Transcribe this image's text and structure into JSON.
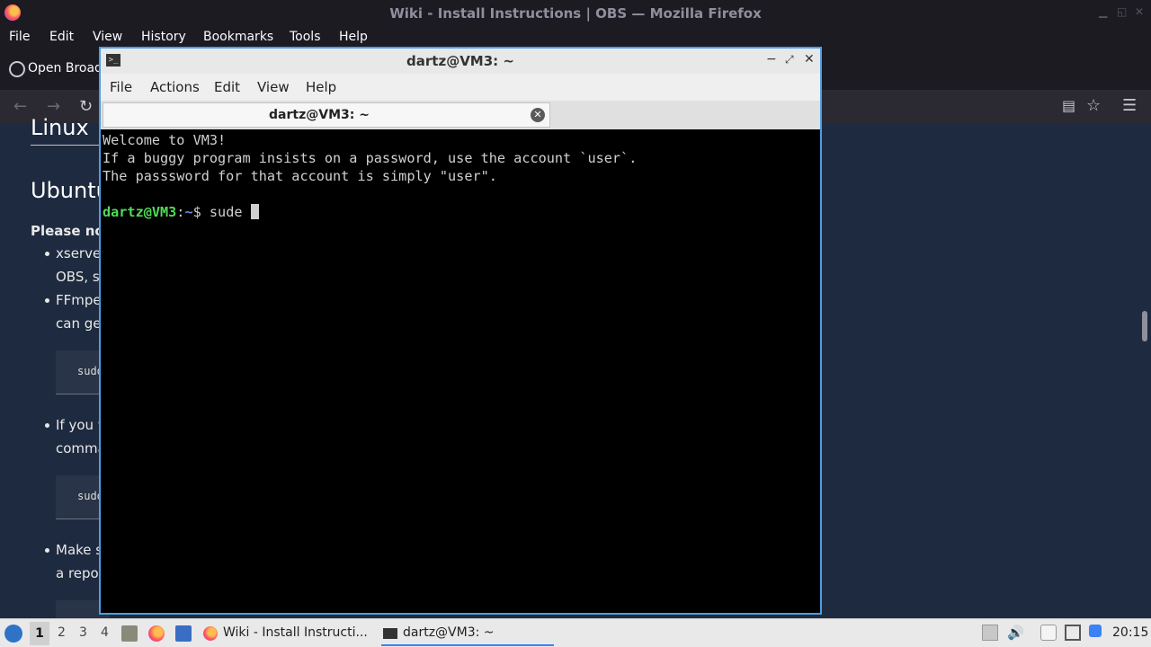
{
  "firefox": {
    "window_title": "Wiki - Install Instructions | OBS — Mozilla Firefox",
    "menu": [
      "File",
      "Edit",
      "View",
      "History",
      "Bookmarks",
      "Tools",
      "Help"
    ],
    "tab_label": "Open Broad",
    "page": {
      "heading_partial": "Linux",
      "section_heading": "Ubuntu",
      "note_label": "Please not",
      "bullet1_line1": "xserve",
      "bullet1_line2": "OBS, s",
      "bullet2_line1": "FFmpe",
      "bullet2_line2": "can ge",
      "code1": "sudo",
      "bullet3_line1": "If you w",
      "bullet3_line2": "comma",
      "code2": "sudo",
      "bullet4_line1": "Make s",
      "bullet4_line2": "a repos"
    }
  },
  "terminal": {
    "window_title": "dartz@VM3: ~",
    "menu": [
      "File",
      "Actions",
      "Edit",
      "View",
      "Help"
    ],
    "tab_label": "dartz@VM3: ~",
    "lines": [
      "Welcome to VM3!",
      "If a buggy program insists on a password, use the account `user`.",
      "The passsword for that account is simply \"user\"."
    ],
    "prompt_user": "dartz@VM3",
    "prompt_sep": ":",
    "prompt_path": "~",
    "prompt_symbol": "$ ",
    "command": "sude "
  },
  "taskbar": {
    "workspaces": [
      "1",
      "2",
      "3",
      "4"
    ],
    "apps": [
      {
        "label": "Wiki - Install Instructi..."
      },
      {
        "label": "dartz@VM3: ~"
      }
    ],
    "clock": "20:15"
  },
  "colors": {
    "terminal_border": "#4b9ee6",
    "prompt_user": "#4fdc57",
    "prompt_path": "#6d8be5",
    "page_bg": "#1e2a3f"
  }
}
